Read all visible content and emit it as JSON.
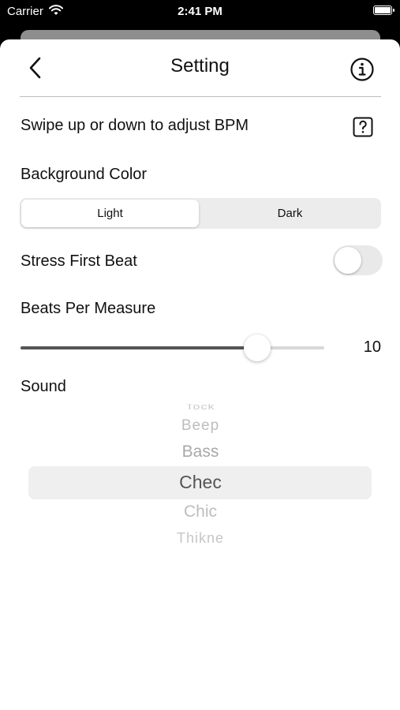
{
  "status_bar": {
    "carrier": "Carrier",
    "time": "2:41 PM"
  },
  "nav": {
    "title": "Setting"
  },
  "settings": {
    "swipe_hint": "Swipe up or down to adjust BPM",
    "background_color_label": "Background Color",
    "background_options": [
      "Light",
      "Dark"
    ],
    "background_selected": "Light",
    "stress_first_beat_label": "Stress First Beat",
    "stress_first_beat_on": false,
    "beats_per_measure_label": "Beats Per Measure",
    "beats_per_measure_value": "10",
    "beats_slider_fraction": 0.78,
    "sound_label": "Sound"
  },
  "sound_picker": {
    "items": [
      "Tock",
      "Beep",
      "Bass",
      "Chec",
      "Chic",
      "Thikne"
    ],
    "selected": "Chec"
  },
  "colors": {
    "accent_track": "#555555",
    "sheet": "#ffffff",
    "segment_bg": "#ececec"
  }
}
